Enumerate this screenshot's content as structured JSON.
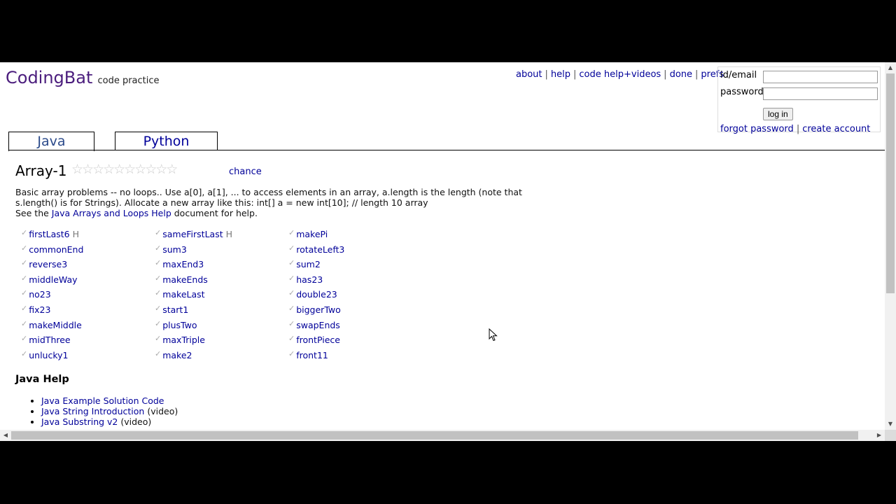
{
  "brand": {
    "logo": "CodingBat",
    "tagline": "code practice"
  },
  "nav": {
    "about": "about",
    "help": "help",
    "code_help_videos": "code help+videos",
    "done": "done",
    "prefs": "prefs",
    "separator": "|"
  },
  "login": {
    "id_label": "id/email",
    "password_label": "password",
    "button": "log in",
    "forgot": "forgot password",
    "create": "create account",
    "id_value": "",
    "password_value": ""
  },
  "tabs": {
    "java": "Java",
    "python": "Python"
  },
  "section": {
    "title": "Array-1",
    "stars": "☆☆☆☆☆☆☆☆☆☆",
    "chance": "chance"
  },
  "description": {
    "line1": "Basic array problems -- no loops.. Use a[0], a[1], ... to access elements in an array, a.length is the length (note that",
    "line2": "s.length() is for Strings). Allocate a new array like this: int[] a = new int[10]; // length 10 array",
    "see_pre": "See the ",
    "see_link": "Java Arrays and Loops Help",
    "see_post": " document for help."
  },
  "problems": {
    "col1": [
      {
        "name": "firstLast6",
        "hint": "H"
      },
      {
        "name": "commonEnd",
        "hint": ""
      },
      {
        "name": "reverse3",
        "hint": ""
      },
      {
        "name": "middleWay",
        "hint": ""
      },
      {
        "name": "no23",
        "hint": ""
      },
      {
        "name": "fix23",
        "hint": ""
      },
      {
        "name": "makeMiddle",
        "hint": ""
      },
      {
        "name": "midThree",
        "hint": ""
      },
      {
        "name": "unlucky1",
        "hint": ""
      }
    ],
    "col2": [
      {
        "name": "sameFirstLast",
        "hint": "H"
      },
      {
        "name": "sum3",
        "hint": ""
      },
      {
        "name": "maxEnd3",
        "hint": ""
      },
      {
        "name": "makeEnds",
        "hint": ""
      },
      {
        "name": "makeLast",
        "hint": ""
      },
      {
        "name": "start1",
        "hint": ""
      },
      {
        "name": "plusTwo",
        "hint": ""
      },
      {
        "name": "maxTriple",
        "hint": ""
      },
      {
        "name": "make2",
        "hint": ""
      }
    ],
    "col3": [
      {
        "name": "makePi",
        "hint": ""
      },
      {
        "name": "rotateLeft3",
        "hint": ""
      },
      {
        "name": "sum2",
        "hint": ""
      },
      {
        "name": "has23",
        "hint": ""
      },
      {
        "name": "double23",
        "hint": ""
      },
      {
        "name": "biggerTwo",
        "hint": ""
      },
      {
        "name": "swapEnds",
        "hint": ""
      },
      {
        "name": "frontPiece",
        "hint": ""
      },
      {
        "name": "front11",
        "hint": ""
      }
    ]
  },
  "help": {
    "title": "Java Help",
    "items": [
      {
        "link": "Java Example Solution Code",
        "suffix": ""
      },
      {
        "link": "Java String Introduction",
        "suffix": " (video)"
      },
      {
        "link": "Java Substring v2",
        "suffix": " (video)"
      }
    ]
  },
  "icons": {
    "check": "check-mark-icon",
    "star": "star-outline-icon"
  },
  "colors": {
    "link": "#000099",
    "logo": "#4b1d7d"
  }
}
